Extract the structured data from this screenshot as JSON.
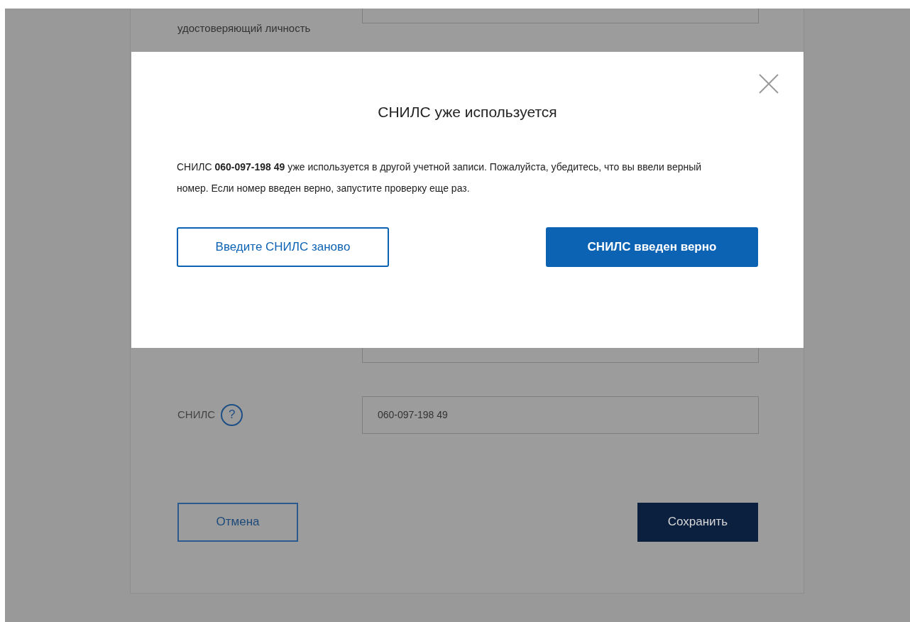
{
  "form": {
    "document_label": "удостоверяющий личность",
    "snils": {
      "label": "СНИЛС",
      "help": "?",
      "value": "060-097-198 49"
    },
    "buttons": [
      {
        "label": "Отмена",
        "kind": "outline"
      },
      {
        "label": "Сохранить",
        "kind": "primary"
      }
    ]
  },
  "dialog": {
    "title": "СНИЛС уже используется",
    "message": "СНИЛС **060-097-198 49** уже используется в другой учетной записи. Пожалуйста, убедитесь, что вы ввели верный номер. Если номер введен верно, запустите проверку еще раз.",
    "buttons": [
      {
        "label": "Введите СНИЛС заново",
        "kind": "outline"
      },
      {
        "label": "СНИЛС введен верно",
        "kind": "primary"
      }
    ]
  }
}
